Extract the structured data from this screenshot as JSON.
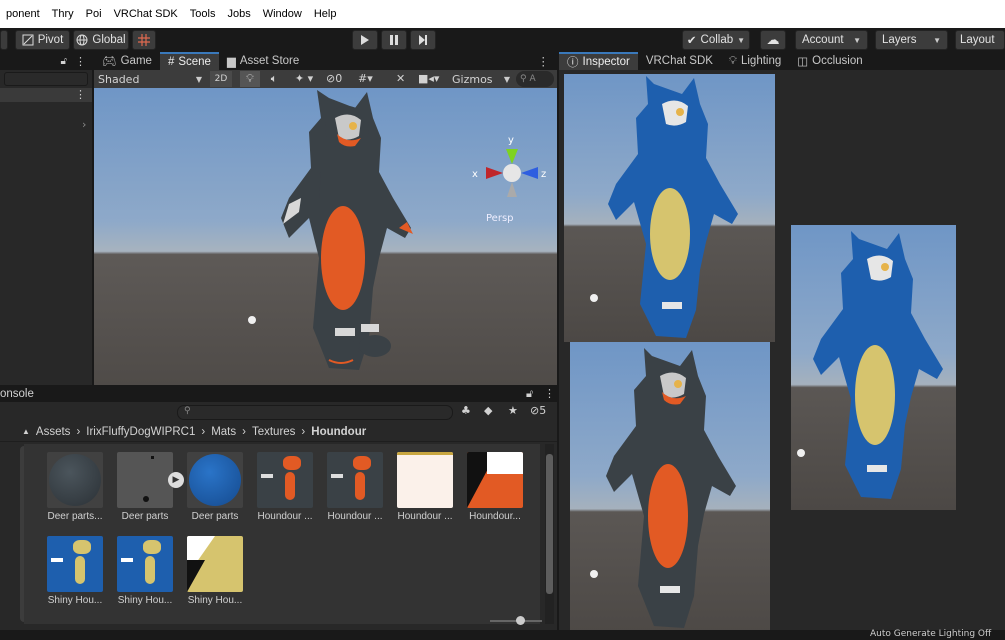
{
  "menu": {
    "items": [
      "ponent",
      "Thry",
      "Poi",
      "VRChat SDK",
      "Tools",
      "Jobs",
      "Window",
      "Help"
    ]
  },
  "toolbar": {
    "pivot": "Pivot",
    "global": "Global",
    "collab": "Collab",
    "account": "Account",
    "layers": "Layers",
    "layout": "Layout"
  },
  "scene_tabs": [
    "Game",
    "Scene",
    "Asset Store"
  ],
  "scene_toolbar": {
    "shading": "Shaded",
    "mode2d": "2D",
    "hidden_count": "0",
    "gizmos": "Gizmos"
  },
  "scene_gizmo": {
    "y": "y",
    "x": "x",
    "z": "z",
    "persp": "Persp"
  },
  "inspector_tabs": [
    "Inspector",
    "VRChat SDK",
    "Lighting",
    "Occlusion"
  ],
  "console": {
    "title": "onsole"
  },
  "project": {
    "hidden_count": "5",
    "breadcrumb": [
      "Assets",
      "IrixFluffyDogWIPRC1",
      "Mats",
      "Textures",
      "Houndour"
    ],
    "assets": [
      {
        "label": "Deer parts...",
        "kind": "sphere-dark"
      },
      {
        "label": "Deer parts",
        "kind": "gray"
      },
      {
        "label": "Deer parts",
        "kind": "sphere-blue"
      },
      {
        "label": "Houndour ...",
        "kind": "tex-dark"
      },
      {
        "label": "Houndour ...",
        "kind": "tex-dark"
      },
      {
        "label": "Houndour ...",
        "kind": "tex-cream"
      },
      {
        "label": "Houndour...",
        "kind": "tex-orange"
      },
      {
        "label": "Shiny Hou...",
        "kind": "tex-blue"
      },
      {
        "label": "Shiny Hou...",
        "kind": "tex-blue"
      },
      {
        "label": "Shiny Hou...",
        "kind": "tex-yellow"
      }
    ]
  },
  "status": {
    "text": "Auto Generate Lighting Off"
  },
  "colors": {
    "accent": "#3a79bb",
    "fur_dark": "#3a4146",
    "fur_blue": "#1e5fae",
    "belly_orange": "#e25a24",
    "belly_yellow": "#d6c46e"
  }
}
